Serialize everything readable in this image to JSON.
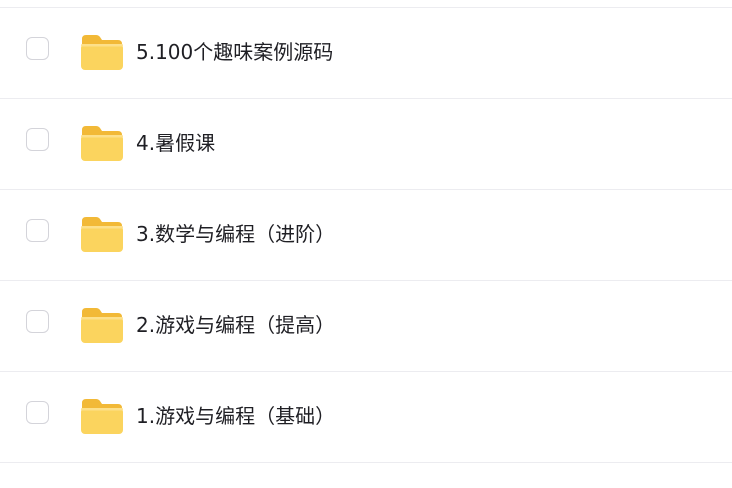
{
  "files": [
    {
      "name": "5.100个趣味案例源码",
      "icon": "folder-icon"
    },
    {
      "name": "4.暑假课",
      "icon": "folder-icon"
    },
    {
      "name": "3.数学与编程（进阶）",
      "icon": "folder-icon"
    },
    {
      "name": "2.游戏与编程（提高）",
      "icon": "folder-icon"
    },
    {
      "name": "1.游戏与编程（基础）",
      "icon": "folder-icon"
    }
  ]
}
